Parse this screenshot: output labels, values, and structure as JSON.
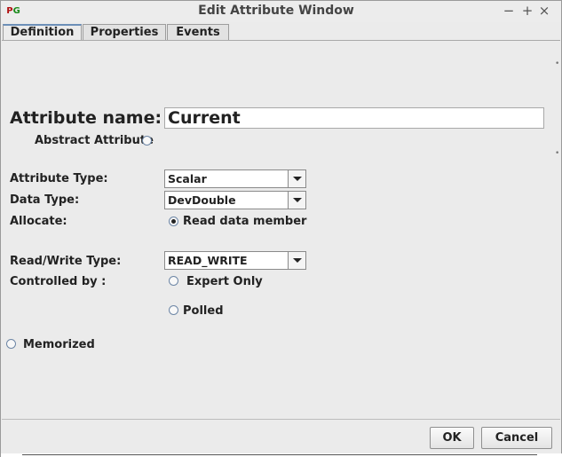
{
  "window": {
    "title": "Edit Attribute Window",
    "controls": {
      "minimize": "−",
      "maximize": "+",
      "close": "×"
    }
  },
  "tabs": [
    {
      "label": "Definition",
      "active": true
    },
    {
      "label": "Properties",
      "active": false
    },
    {
      "label": "Events",
      "active": false
    }
  ],
  "form": {
    "attribute_name_label": "Attribute name:",
    "attribute_name_value": "Current",
    "abstract_label": "Abstract Attribute",
    "abstract_checked": false,
    "attribute_type_label": "Attribute Type:",
    "attribute_type_value": "Scalar",
    "data_type_label": "Data Type:",
    "data_type_value": "DevDouble",
    "allocate_label": "Allocate:",
    "read_data_member_label": "Read data member",
    "read_data_member_checked": true,
    "rw_type_label": "Read/Write Type:",
    "rw_type_value": "READ_WRITE",
    "controlled_by_label": "Controlled by :",
    "expert_only_label": "Expert Only",
    "expert_only_checked": false,
    "polled_label": "Polled",
    "polled_checked": false,
    "memorized_label": "Memorized",
    "memorized_checked": false
  },
  "buttons": {
    "ok": "OK",
    "cancel": "Cancel"
  },
  "colors": {
    "background": "#ebebeb",
    "tab_accent": "#6c8fb8",
    "radio_border": "#6d86a6"
  },
  "icons": {
    "app": "pogo-app-icon",
    "combo_arrow": "chevron-down-icon"
  }
}
